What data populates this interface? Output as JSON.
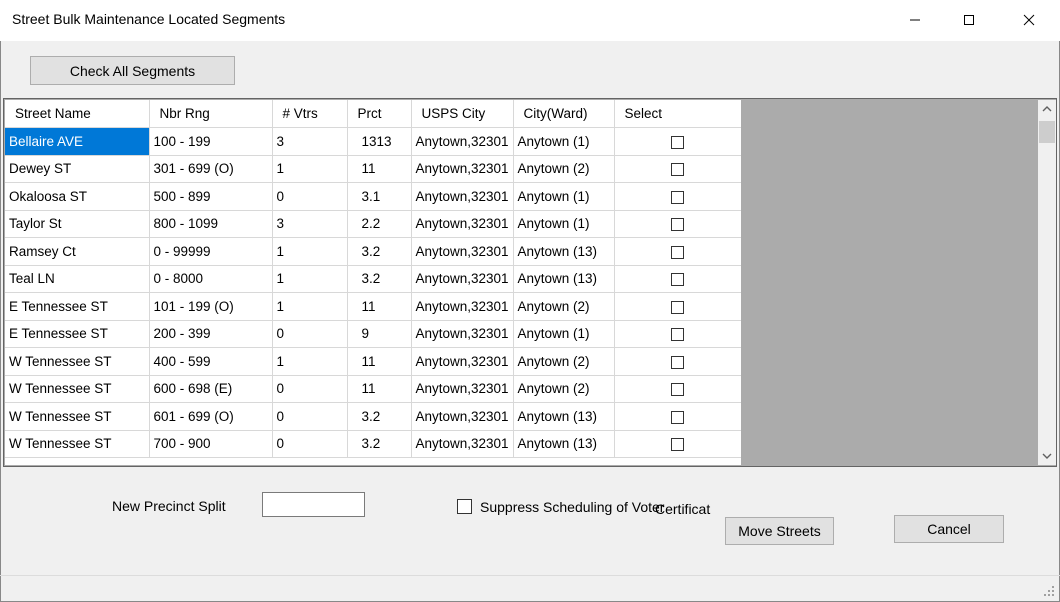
{
  "window": {
    "title": "Street Bulk Maintenance Located Segments"
  },
  "toolbar": {
    "check_all_label": "Check All Segments"
  },
  "grid": {
    "columns": [
      "Street Name",
      "Nbr Rng",
      "# Vtrs",
      "Prct",
      "USPS City",
      "City(Ward)",
      "Select"
    ],
    "rows": [
      {
        "street": "Bellaire AVE",
        "range": "100 - 199",
        "voters": "3",
        "prct": "1313",
        "usps": "Anytown,32301",
        "ward": "Anytown (1)",
        "selected": false
      },
      {
        "street": "Dewey ST",
        "range": "301 - 699 (O)",
        "voters": "1",
        "prct": "11",
        "usps": "Anytown,32301",
        "ward": "Anytown (2)",
        "selected": false
      },
      {
        "street": "Okaloosa ST",
        "range": "500 - 899",
        "voters": "0",
        "prct": "3.1",
        "usps": "Anytown,32301",
        "ward": "Anytown (1)",
        "selected": false
      },
      {
        "street": "Taylor St",
        "range": "800 - 1099",
        "voters": "3",
        "prct": "2.2",
        "usps": "Anytown,32301",
        "ward": "Anytown (1)",
        "selected": false
      },
      {
        "street": "Ramsey Ct",
        "range": "0 - 99999",
        "voters": "1",
        "prct": "3.2",
        "usps": "Anytown,32301",
        "ward": "Anytown (13)",
        "selected": false
      },
      {
        "street": "Teal LN",
        "range": "0 - 8000",
        "voters": "1",
        "prct": "3.2",
        "usps": "Anytown,32301",
        "ward": "Anytown (13)",
        "selected": false
      },
      {
        "street": "E Tennessee ST",
        "range": "101 - 199 (O)",
        "voters": "1",
        "prct": "11",
        "usps": "Anytown,32301",
        "ward": "Anytown (2)",
        "selected": false
      },
      {
        "street": "E Tennessee ST",
        "range": "200 - 399",
        "voters": "0",
        "prct": "9",
        "usps": "Anytown,32301",
        "ward": "Anytown (1)",
        "selected": false
      },
      {
        "street": "W Tennessee ST",
        "range": "400 - 599",
        "voters": "1",
        "prct": "11",
        "usps": "Anytown,32301",
        "ward": "Anytown (2)",
        "selected": false
      },
      {
        "street": "W Tennessee ST",
        "range": "600 - 698 (E)",
        "voters": "0",
        "prct": "11",
        "usps": "Anytown,32301",
        "ward": "Anytown (2)",
        "selected": false
      },
      {
        "street": "W Tennessee ST",
        "range": "601 - 699 (O)",
        "voters": "0",
        "prct": "3.2",
        "usps": "Anytown,32301",
        "ward": "Anytown (13)",
        "selected": false
      },
      {
        "street": "W Tennessee ST",
        "range": "700 - 900",
        "voters": "0",
        "prct": "3.2",
        "usps": "Anytown,32301",
        "ward": "Anytown (13)",
        "selected": false
      }
    ]
  },
  "form": {
    "precinct_label": "New Precinct Split",
    "precinct_value": "",
    "suppress_label": "Suppress Scheduling of Voter",
    "suppress_label_overflow": "Certificat",
    "suppress_checked": false,
    "move_label": "Move Streets",
    "cancel_label": "Cancel"
  },
  "colors": {
    "selection": "#0078d7",
    "window_bg": "#f0f0f0",
    "grid_empty_bg": "#ababab"
  },
  "icons": {
    "minimize": "minimize-icon",
    "maximize": "maximize-icon",
    "close": "close-icon",
    "scroll_up": "chevron-up-icon",
    "scroll_down": "chevron-down-icon",
    "resize_grip": "resize-grip-icon"
  }
}
